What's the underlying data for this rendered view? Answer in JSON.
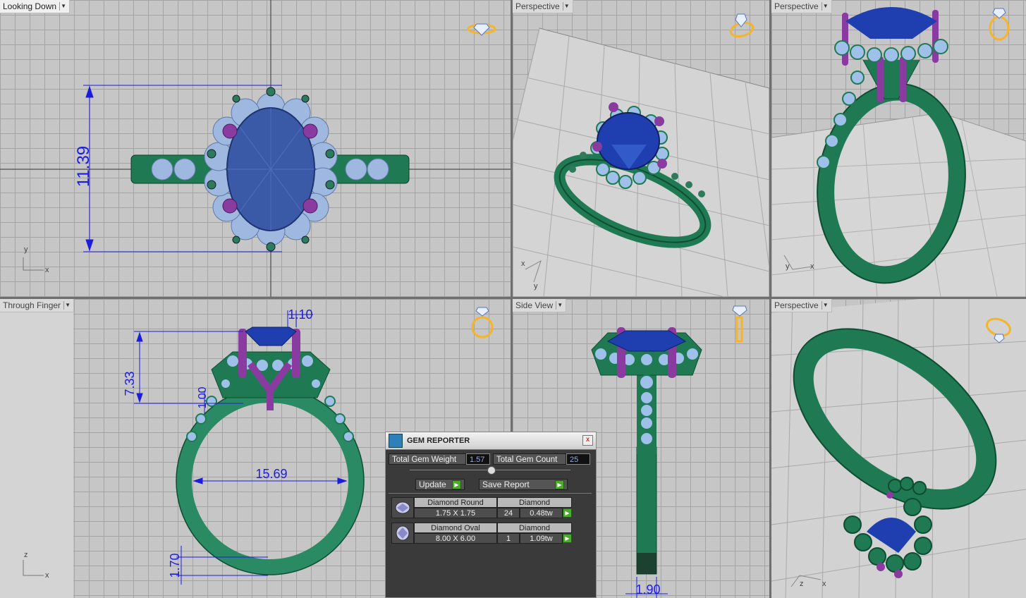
{
  "viewports": {
    "top_left": {
      "label": "Looking Down",
      "axis_y": "y",
      "axis_x": "x",
      "dimension": "11.39"
    },
    "top_mid": {
      "label": "Perspective",
      "axis_x": "x",
      "axis_y": "y"
    },
    "top_right": {
      "label": "Perspective",
      "axis_x": "x",
      "axis_y": "y"
    },
    "bottom_left": {
      "label": "Through Finger",
      "axis_z": "z",
      "axis_x": "x",
      "dims": {
        "prong": "1.10",
        "height": "7.33",
        "gap": "1.00",
        "inner": "15.69",
        "shank": "1.70"
      }
    },
    "bottom_mid": {
      "label": "Side View",
      "dim": "1.90"
    },
    "bottom_right": {
      "label": "Perspective",
      "axis_x": "x",
      "axis_z": "z"
    }
  },
  "gem_reporter": {
    "title": "GEM REPORTER",
    "close": "x",
    "total_weight_label": "Total Gem Weight",
    "total_weight": "1.57",
    "total_count_label": "Total Gem Count",
    "total_count": "25",
    "update_label": "Update",
    "save_label": "Save Report",
    "items": [
      {
        "name": "Diamond Round",
        "material": "Diamond",
        "size": "1.75 X 1.75",
        "count": "24",
        "weight": "0.48tw"
      },
      {
        "name": "Diamond Oval",
        "material": "Diamond",
        "size": "8.00 X 6.00",
        "count": "1",
        "weight": "1.09tw"
      }
    ]
  },
  "colors": {
    "metal": "#1f7a54",
    "center_stone": "#2e4fa8",
    "halo": "#9fb8e0",
    "prong": "#8a3ba0",
    "dimension": "#1c1ce0",
    "grid": "#a3a3a3",
    "background": "#c6c6c6"
  },
  "icons": [
    "diamond-ring-icon",
    "play-icon",
    "close-icon"
  ]
}
